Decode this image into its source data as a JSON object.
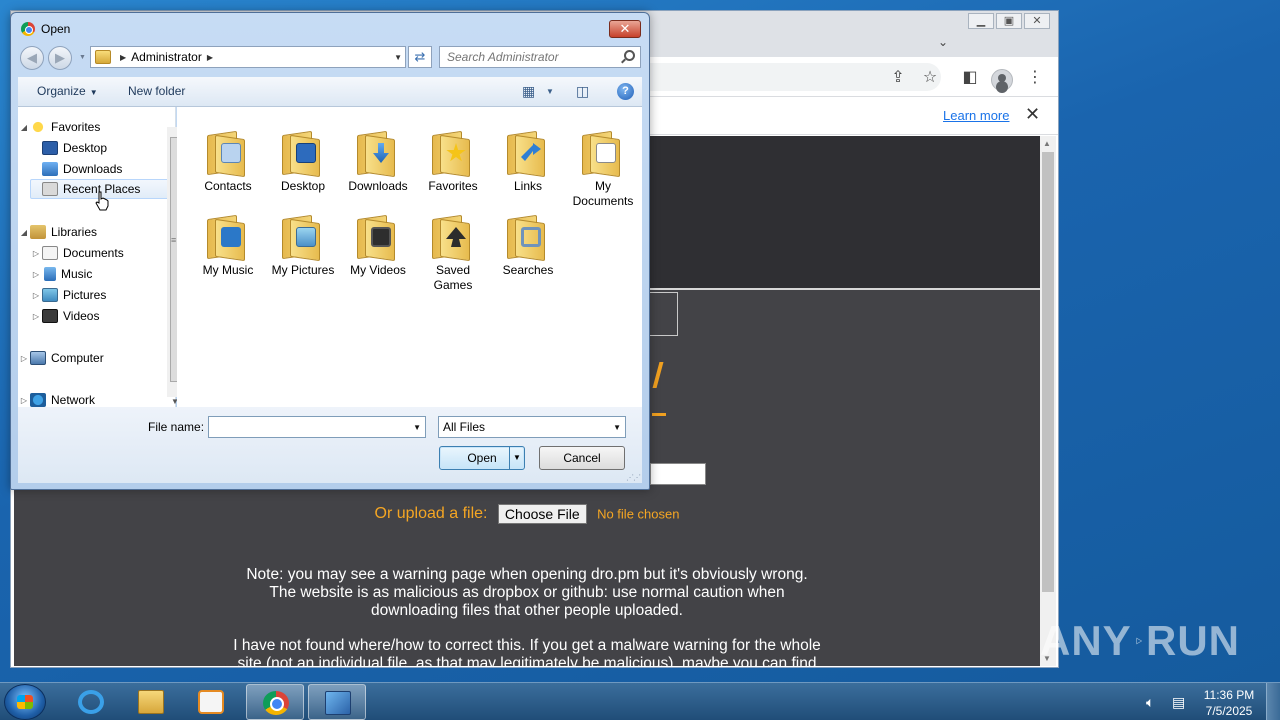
{
  "browser": {
    "infobar": {
      "learn_more": "Learn more",
      "close": "✕"
    },
    "page": {
      "upload_label": "Or upload a file:",
      "choose_file": "Choose File",
      "no_file": "No file chosen",
      "note1": [
        "Note: you may see a warning page when opening dro.pm but it's obviously wrong.",
        "The website is as malicious as dropbox or github: use normal caution when",
        "downloading files that other people uploaded."
      ],
      "note2": [
        "I have not found where/how to correct this. If you get a malware warning for the whole",
        "site (not an individual file, as that may legitimately be malicious), maybe you can find"
      ]
    }
  },
  "dialog": {
    "title": "Open",
    "close": "✕",
    "address": {
      "crumbs": [
        "Administrator"
      ]
    },
    "search_placeholder": "Search Administrator",
    "toolbar": {
      "organize": "Organize",
      "new_folder": "New folder"
    },
    "nav": {
      "favorites": "Favorites",
      "desktop": "Desktop",
      "downloads": "Downloads",
      "recent": "Recent Places",
      "libraries": "Libraries",
      "documents": "Documents",
      "music": "Music",
      "pictures": "Pictures",
      "videos": "Videos",
      "computer": "Computer",
      "network": "Network"
    },
    "files": [
      [
        "Contacts"
      ],
      [
        "Desktop"
      ],
      [
        "Downloads"
      ],
      [
        "Favorites"
      ],
      [
        "Links"
      ],
      [
        "My",
        "Documents"
      ],
      [
        "My Music"
      ],
      [
        "My Pictures"
      ],
      [
        "My Videos"
      ],
      [
        "Saved",
        "Games"
      ],
      [
        "Searches"
      ]
    ],
    "file_name_label": "File name:",
    "file_name_value": "",
    "filter": "All Files",
    "open_button": "Open",
    "cancel_button": "Cancel"
  },
  "taskbar": {
    "time": "11:36 PM",
    "date": "7/5/2025"
  },
  "watermark": {
    "left": "ANY",
    "right": "RUN"
  }
}
